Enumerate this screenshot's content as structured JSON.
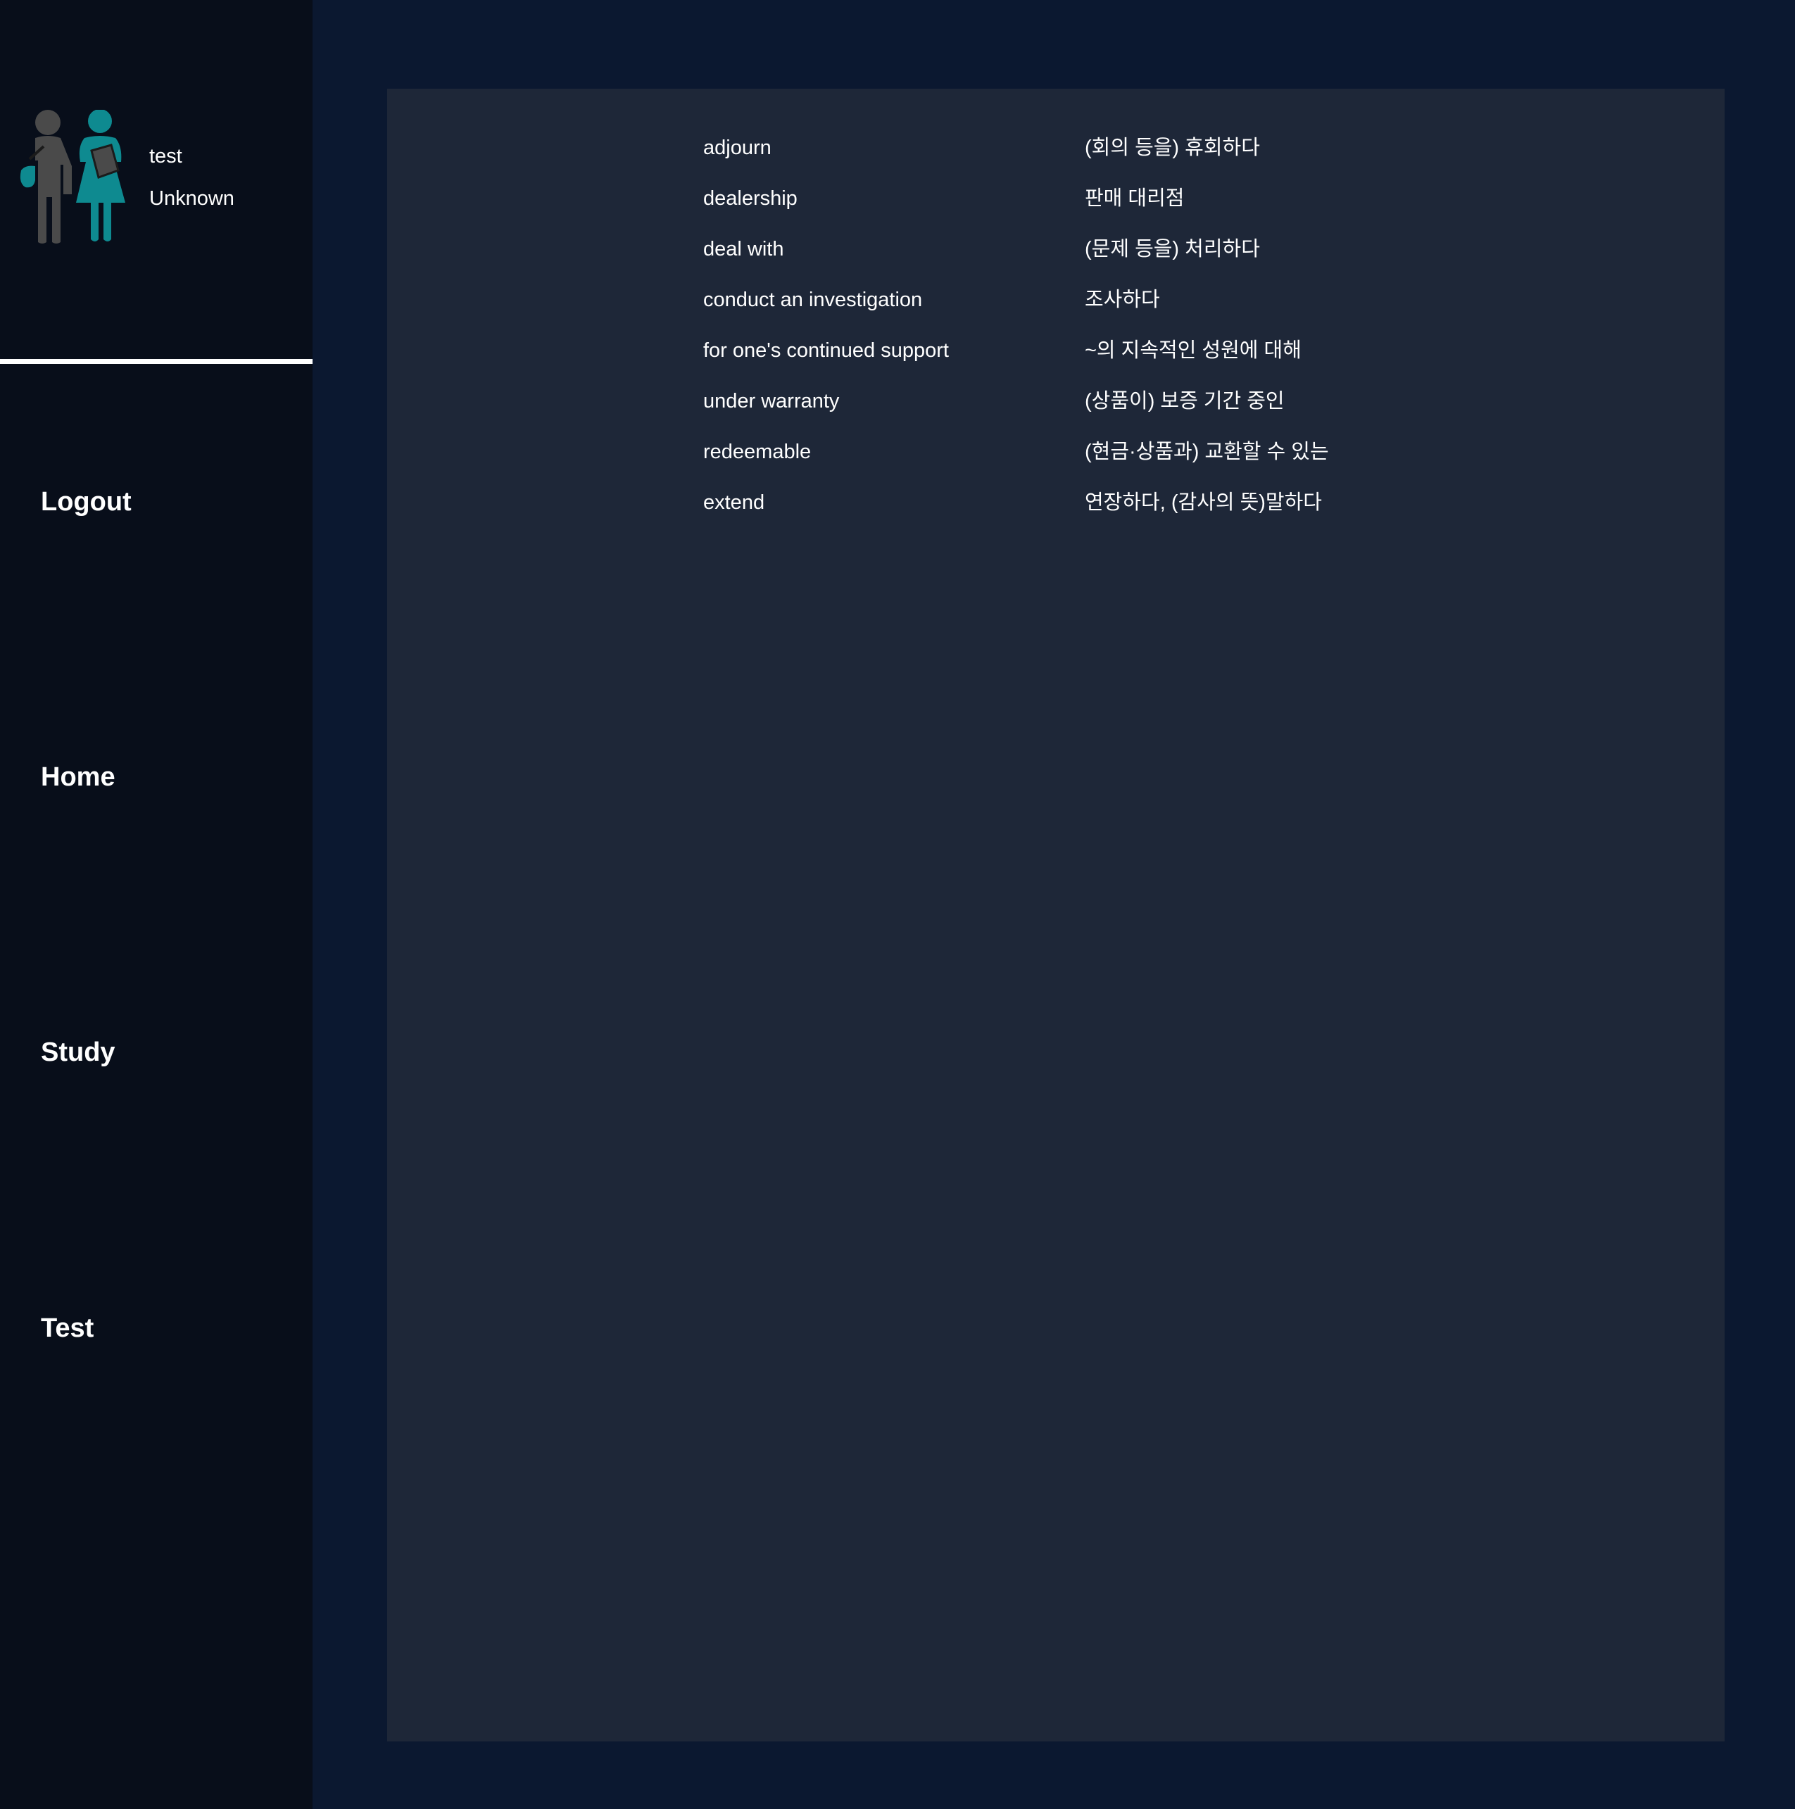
{
  "user": {
    "name": "test",
    "status": "Unknown"
  },
  "nav": {
    "logout": "Logout",
    "home": "Home",
    "study": "Study",
    "test": "Test"
  },
  "words": [
    {
      "term": "adjourn",
      "meaning": "(회의 등을) 휴회하다"
    },
    {
      "term": "dealership",
      "meaning": "판매 대리점"
    },
    {
      "term": "deal with",
      "meaning": "(문제 등을) 처리하다"
    },
    {
      "term": "conduct an investigation",
      "meaning": "조사하다"
    },
    {
      "term": "for one's continued support",
      "meaning": "~의 지속적인 성원에 대해"
    },
    {
      "term": "under warranty",
      "meaning": "(상품이) 보증 기간 중인"
    },
    {
      "term": "redeemable",
      "meaning": "(현금·상품과) 교환할 수 있는"
    },
    {
      "term": "extend",
      "meaning": "연장하다, (감사의 뜻)말하다"
    }
  ],
  "icons": {
    "avatar": "students-icon"
  },
  "colors": {
    "page_bg": "#0b1830",
    "sidebar_bg": "#080e1a",
    "panel_bg": "#1e2738",
    "accent_teal": "#0e8a90",
    "figure_gray": "#4a4a4a",
    "text": "#ffffff"
  }
}
